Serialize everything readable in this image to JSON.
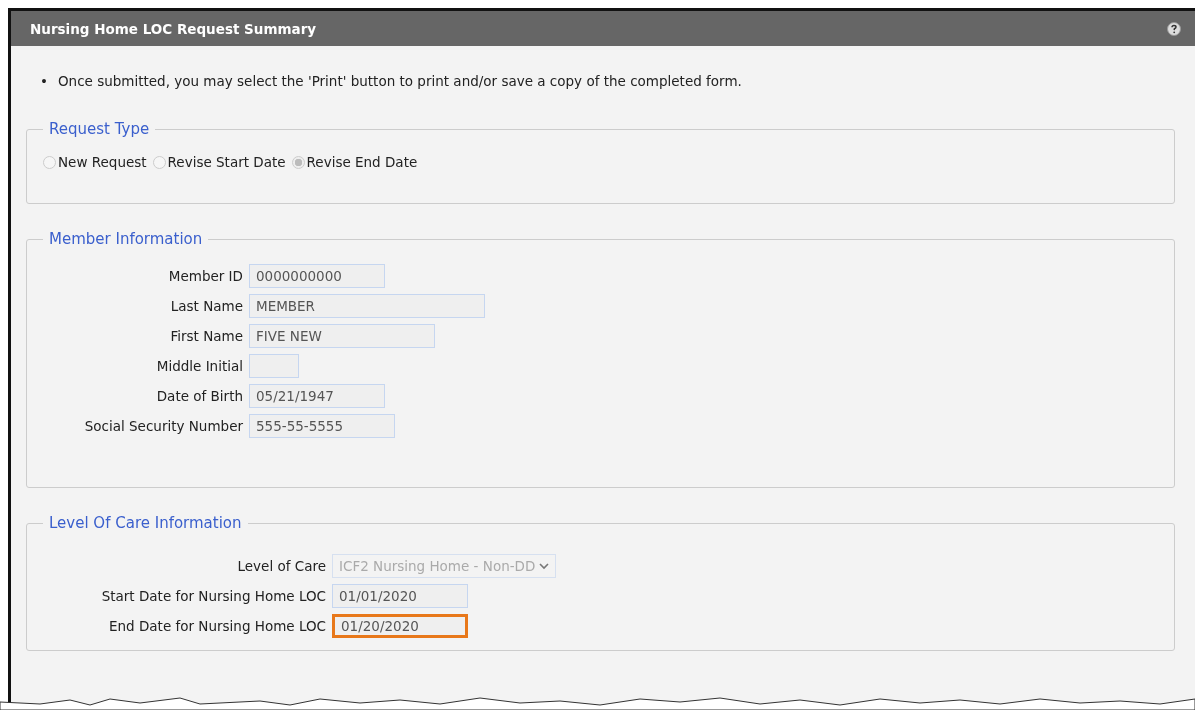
{
  "panel": {
    "title": "Nursing Home LOC Request Summary"
  },
  "instructions": [
    {
      "bullet": "•",
      "text": "Once submitted, you may select the 'Print' button to print and/or save a copy of the completed form."
    }
  ],
  "request_type": {
    "legend": "Request Type",
    "options": [
      {
        "label": "New Request",
        "selected": false
      },
      {
        "label": "Revise Start Date",
        "selected": false
      },
      {
        "label": "Revise End Date",
        "selected": true
      }
    ]
  },
  "member_information": {
    "legend": "Member Information",
    "fields": [
      {
        "label": "Member ID",
        "value": "0000000000"
      },
      {
        "label": "Last Name",
        "value": "MEMBER"
      },
      {
        "label": "First Name",
        "value": "FIVE NEW"
      },
      {
        "label": "Middle Initial"
      },
      {
        "label": "Date of Birth",
        "value": "05/21/1947"
      },
      {
        "label": "Social Security Number",
        "value": "555-55-5555"
      }
    ]
  },
  "level_of_care_information": {
    "legend": "Level Of Care Information",
    "fields": [
      {
        "label": "Level of Care",
        "value": "ICF2 Nursing Home - Non-DD",
        "kind": "select",
        "highlighted": false
      },
      {
        "label": "Start Date for Nursing Home LOC",
        "value": "01/01/2020",
        "kind": "text",
        "highlighted": false
      },
      {
        "label": "End Date for Nursing Home LOC",
        "value": "01/20/2020",
        "kind": "text",
        "highlighted": true
      }
    ]
  }
}
